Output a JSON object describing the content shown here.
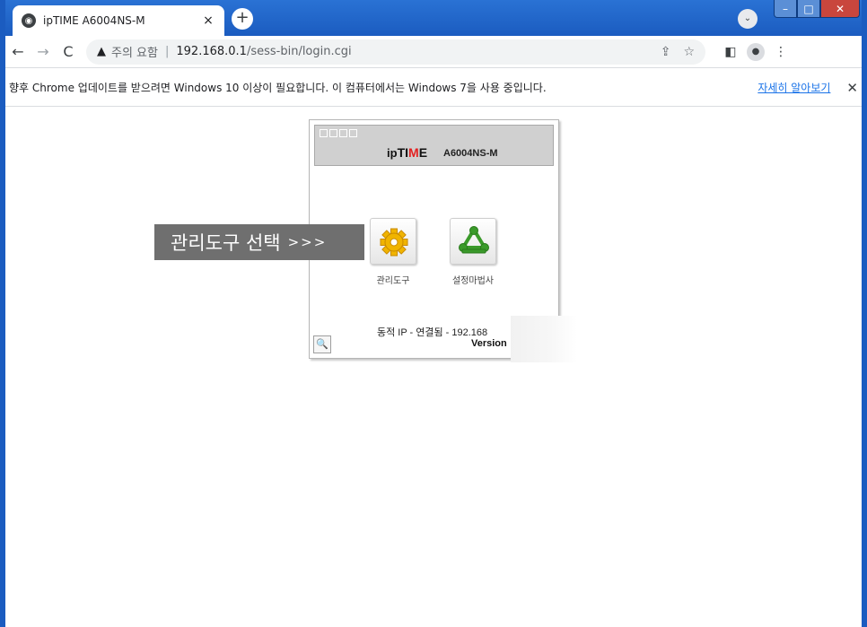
{
  "browser": {
    "tab_title": "ipTIME A6004NS-M",
    "tab_close": "×",
    "new_tab": "+",
    "tab_search": "⌄",
    "win_min": "–",
    "win_max": "□",
    "win_close": "✕",
    "nav_back": "←",
    "nav_forward": "→",
    "nav_reload": "C",
    "security_warning": "주의 요함",
    "url_host": "192.168.0.1",
    "url_path": "/sess-bin/login.cgi",
    "share_icon": "⇪",
    "star_icon": "☆",
    "sidepanel_icon": "◧",
    "profile_icon": "●",
    "menu_icon": "⋮"
  },
  "infobar": {
    "message": "향후 Chrome 업데이트를 받으려면 Windows 10 이상이 필요합니다. 이 컴퓨터에서는 Windows 7을 사용 중입니다.",
    "learn_more": "자세히 알아보기",
    "close": "✕"
  },
  "router": {
    "brand_ip": "ip",
    "brand_ti": "TI",
    "brand_m": "M",
    "brand_e": "E",
    "model": "A6004NS-M",
    "callout_text": "관리도구 선택",
    "callout_arrows": ">>>",
    "admin_label": "관리도구",
    "wizard_label": "설정마법사",
    "status": "동적 IP - 연결됨 - 192.168",
    "version": "Version",
    "zoom_icon": "🔍"
  },
  "colors": {
    "titlebar": "#1b5cc0",
    "accent_red": "#e32020",
    "callout_bg": "#6f6f6f",
    "gear_yellow": "#f0b400",
    "wizard_green": "#3a9a2a"
  }
}
